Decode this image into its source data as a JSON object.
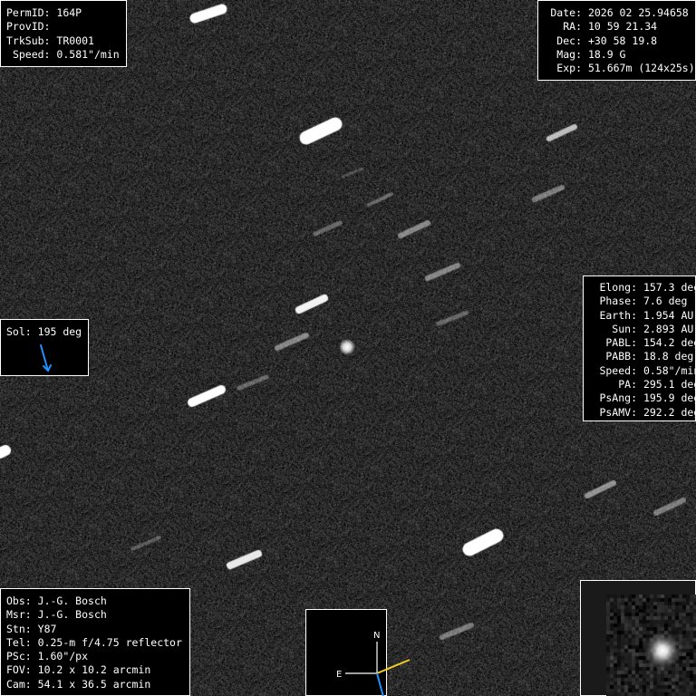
{
  "object": {
    "permid_label": "PermID:",
    "permid": "164P",
    "provid_label": "ProvID:",
    "provid": "",
    "trksub_label": "TrkSub:",
    "trksub": "TR0001",
    "speed_label": "Speed:",
    "speed": "0.581\"/min"
  },
  "observation": {
    "date_label": "Date:",
    "date": "2026 02 25.94658",
    "ra_label": "RA:",
    "ra": "10 59 21.34",
    "dec_label": "Dec:",
    "dec": "+30 58 19.8",
    "mag_label": "Mag:",
    "mag": "18.9 G",
    "exp_label": "Exp:",
    "exp": "51.667m (124x25s)"
  },
  "geometry": {
    "elong_label": "Elong:",
    "elong": "157.3 deg",
    "phase_label": "Phase:",
    "phase": "7.6 deg",
    "earth_label": "Earth:",
    "earth": "1.954 AU",
    "sun_label": "Sun:",
    "sun": "2.893 AU",
    "pabl_label": "PABL:",
    "pabl": "154.2 deg",
    "pabb_label": "PABB:",
    "pabb": "18.8 deg",
    "speed_label": "Speed:",
    "speed": "0.58\"/min",
    "pa_label": "PA:",
    "pa": "295.1 deg",
    "psang_label": "PsAng:",
    "psang": "195.9 deg",
    "psamv_label": "PsAMV:",
    "psamv": "292.2 deg"
  },
  "sol": {
    "label": "Sol:",
    "value": "195 deg",
    "arrow_color": "#1e90ff"
  },
  "observer": {
    "obs_label": "Obs:",
    "obs": "J.-G. Bosch",
    "msr_label": "Msr:",
    "msr": "J.-G. Bosch",
    "stn_label": "Stn:",
    "stn": "Y87",
    "tel_label": "Tel:",
    "tel": "0.25-m f/4.75 reflector",
    "psc_label": "PSc:",
    "psc": "1.60\"/px",
    "fov_label": "FOV:",
    "fov": "10.2 x 10.2 arcmin",
    "cam_label": "Cam:",
    "cam": "54.1 x 36.5 arcmin"
  },
  "compass": {
    "north": "N",
    "east": "E",
    "motion_color": "#f5d020",
    "sun_color": "#1e90ff"
  }
}
